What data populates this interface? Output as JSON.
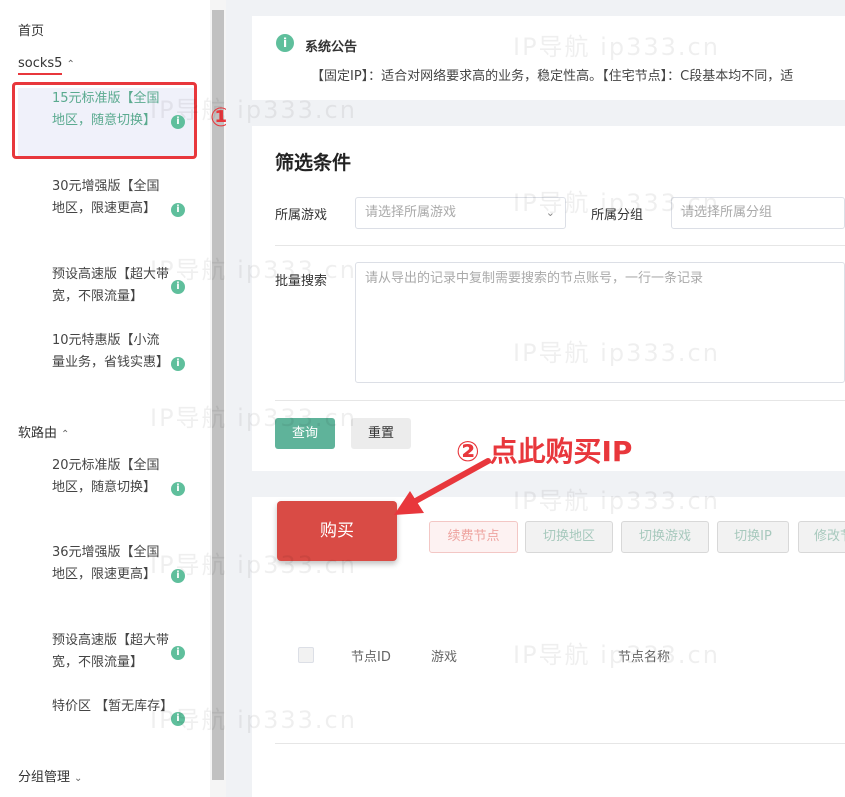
{
  "sidebar": {
    "home": "首页",
    "groups": [
      {
        "label": "socks5",
        "items": [
          {
            "label": "15元标准版【全国地区，随意切换】",
            "active": true
          },
          {
            "label": "30元增强版【全国地区，限速更高】"
          },
          {
            "label": "预设高速版【超大带宽，不限流量】"
          },
          {
            "label": "10元特惠版【小流量业务，省钱实惠】"
          }
        ]
      },
      {
        "label": "软路由",
        "items": [
          {
            "label": "20元标准版【全国地区，随意切换】"
          },
          {
            "label": "36元增强版【全国地区，限速更高】"
          },
          {
            "label": "预设高速版【超大带宽，不限流量】"
          },
          {
            "label": "特价区 【暂无库存】"
          }
        ]
      }
    ],
    "group_manage": "分组管理",
    "info_glyph": "i"
  },
  "annotations": {
    "step1": "①",
    "step2": "② 点此购买IP",
    "color": "#e8373c"
  },
  "notice": {
    "title": "系统公告",
    "text": "【固定IP】：适合对网络要求高的业务，稳定性高。【住宅节点】：C段基本均不同，适"
  },
  "filter": {
    "title": "筛选条件",
    "game_label": "所属游戏",
    "game_placeholder": "请选择所属游戏",
    "group_label": "所属分组",
    "group_placeholder": "请选择所属分组",
    "batch_label": "批量搜索",
    "batch_placeholder": "请从导出的记录中复制需要搜索的节点账号，一行一条记录",
    "query": "查询",
    "reset": "重置"
  },
  "actions": {
    "buy": "购买",
    "renew": "续费节点",
    "switch_region": "切换地区",
    "switch_game": "切换游戏",
    "switch_ip": "切换IP",
    "modify": "修改节"
  },
  "table": {
    "headers": [
      "节点ID",
      "游戏",
      "节点名称"
    ]
  },
  "watermark": "IP导航 ip333.cn",
  "colors": {
    "accent": "#5fb39a",
    "buy": "#d94b45",
    "highlight": "#e8373c"
  }
}
